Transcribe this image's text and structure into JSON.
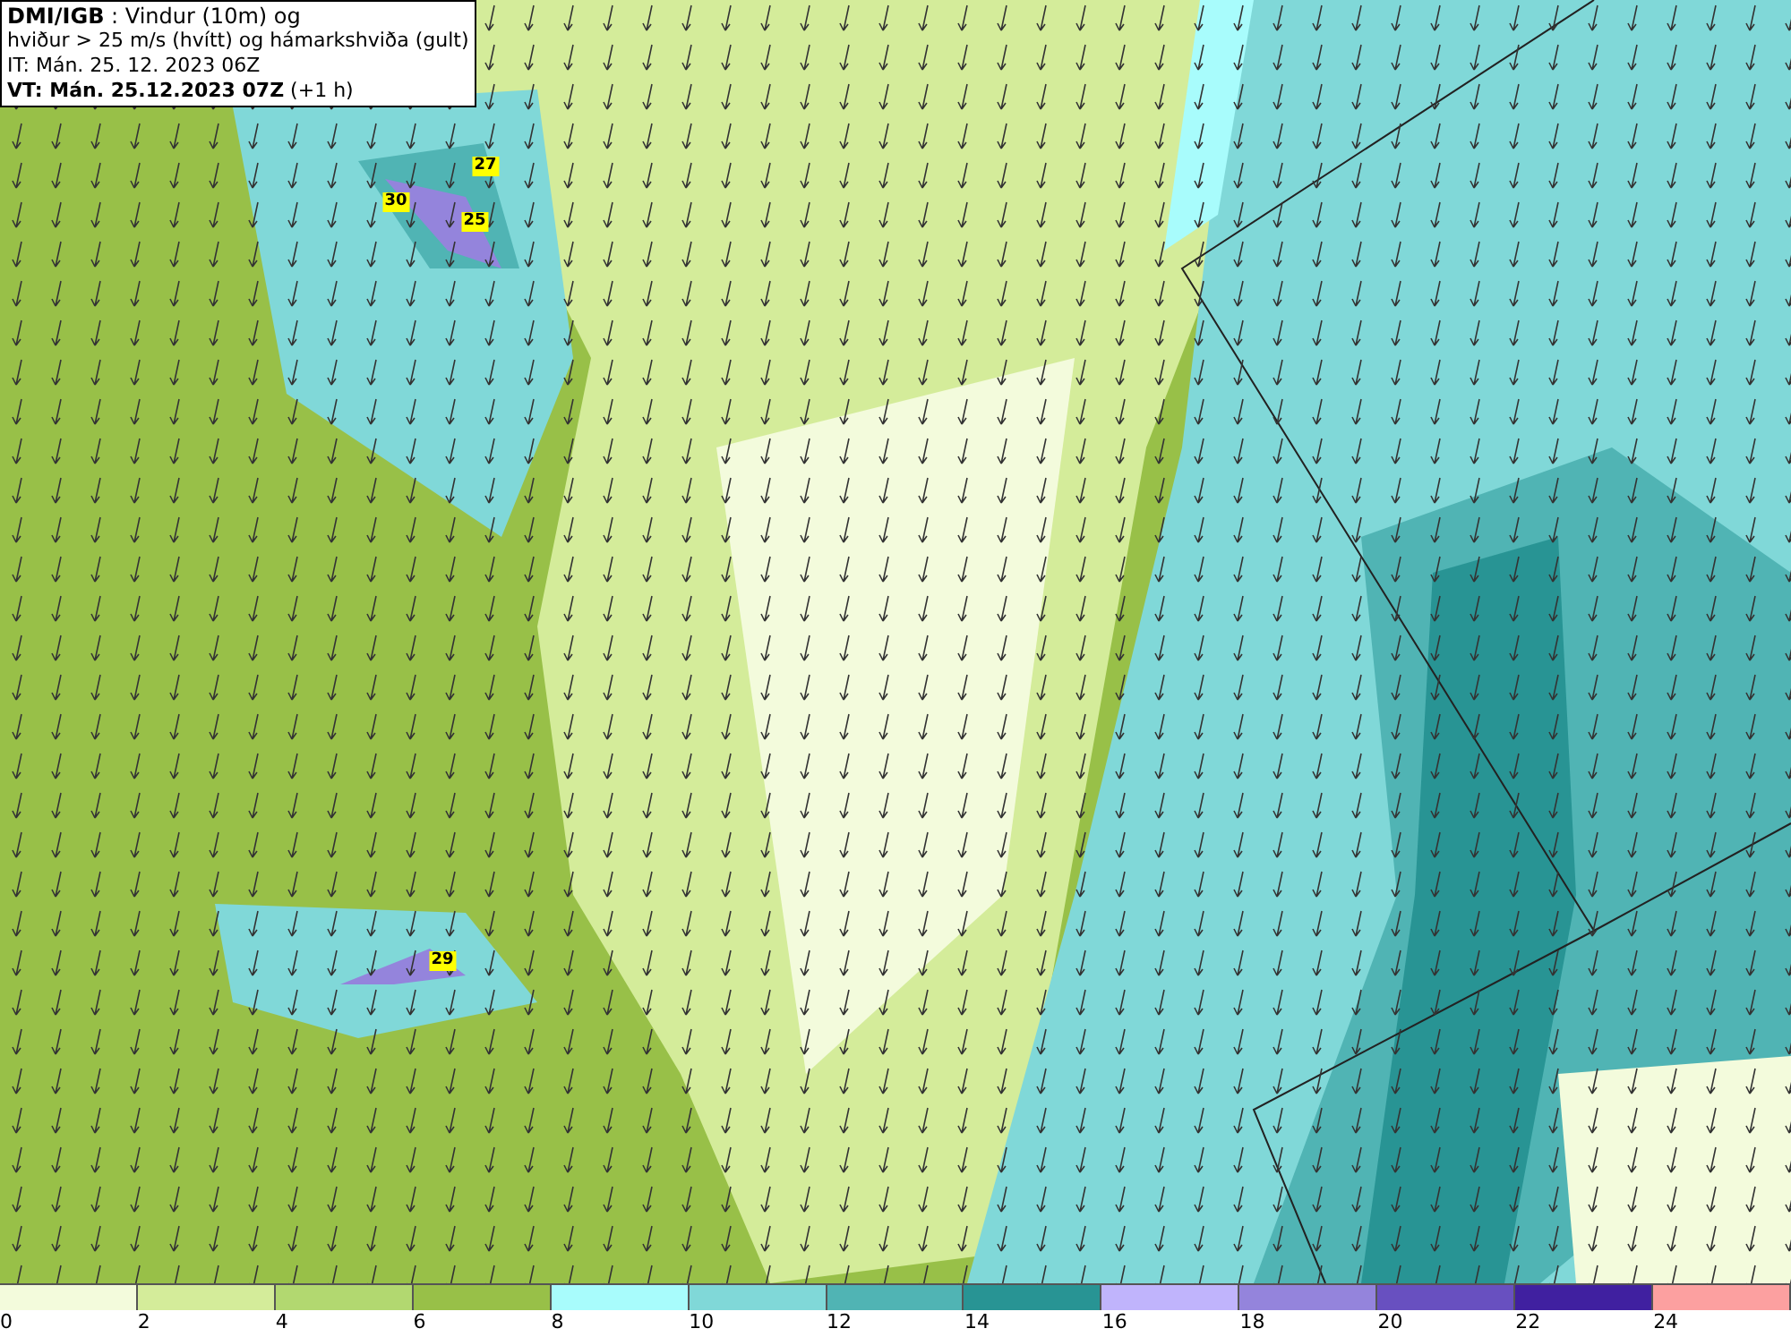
{
  "header": {
    "lines": [
      "**DMI/IGB** : Vindur (10m) og",
      "hviður > 25 m/s (hvítt) og hámarkshviða (gult)",
      "IT: Mán. 25. 12. 2023 06Z",
      "**VT: Mán. 25.12.2023 07Z** (+1 h)"
    ]
  },
  "map": {
    "gust_labels": [
      "27",
      "30",
      "25",
      "29"
    ]
  },
  "legend": [
    {
      "label": "0",
      "color": "#f3fbdc"
    },
    {
      "label": "2",
      "color": "#d4ec9a"
    },
    {
      "label": "4",
      "color": "#b2d870"
    },
    {
      "label": "6",
      "color": "#98c048"
    },
    {
      "label": "8",
      "color": "#a8fcfc"
    },
    {
      "label": "10",
      "color": "#80d8d8"
    },
    {
      "label": "12",
      "color": "#50b4b4"
    },
    {
      "label": "14",
      "color": "#289494"
    },
    {
      "label": "16",
      "color": "#c0b4fc"
    },
    {
      "label": "18",
      "color": "#9484dc"
    },
    {
      "label": "20",
      "color": "#6850c0"
    },
    {
      "label": "22",
      "color": "#4020a0"
    },
    {
      "label": "24",
      "color": "#fca0a0"
    }
  ]
}
